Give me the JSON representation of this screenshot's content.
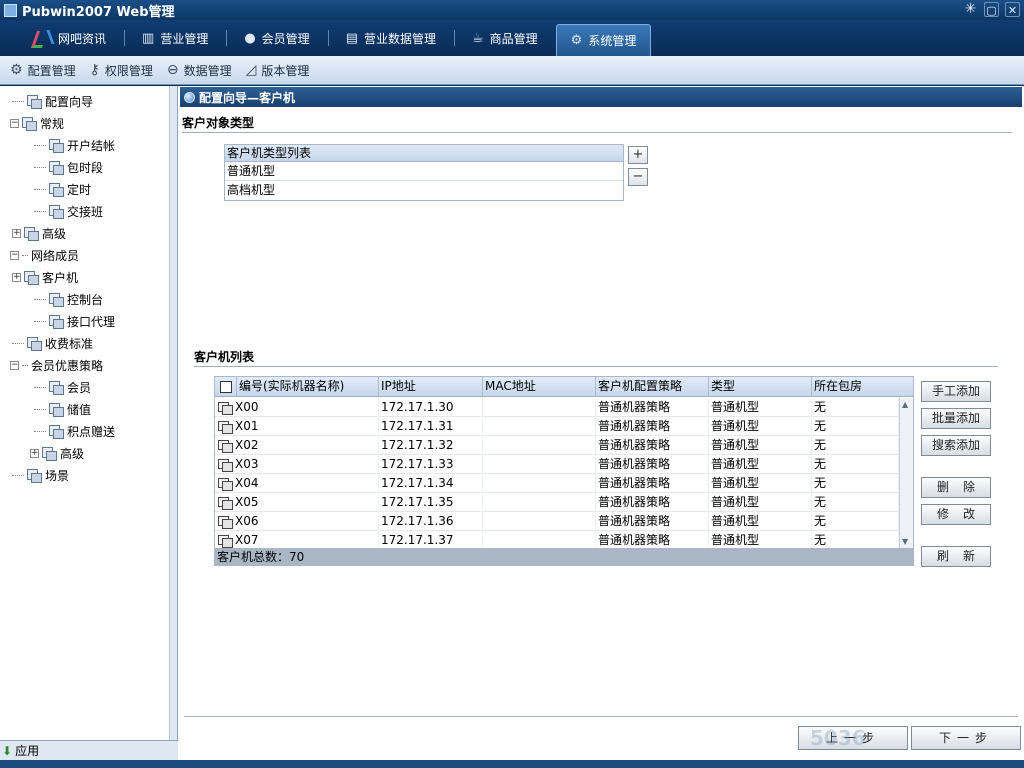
{
  "window": {
    "title": "Pubwin2007 Web管理",
    "controls": [
      "✳",
      "▢",
      "✕"
    ]
  },
  "main_nav": [
    {
      "label": "网吧资讯",
      "icon": "logo-icon"
    },
    {
      "label": "营业管理",
      "icon": "bar-chart-icon"
    },
    {
      "label": "会员管理",
      "icon": "user-icon"
    },
    {
      "label": "营业数据管理",
      "icon": "document-icon"
    },
    {
      "label": "商品管理",
      "icon": "cup-icon"
    },
    {
      "label": "系统管理",
      "icon": "gear-icon",
      "active": true
    }
  ],
  "sub_nav": [
    {
      "label": "配置管理",
      "icon": "gear-icon"
    },
    {
      "label": "权限管理",
      "icon": "key-icon"
    },
    {
      "label": "数据管理",
      "icon": "database-icon"
    },
    {
      "label": "版本管理",
      "icon": "chart-icon"
    }
  ],
  "tree": [
    {
      "label": "配置向导",
      "level": 1,
      "expander": ""
    },
    {
      "label": "常规",
      "level": 0,
      "expander": "−"
    },
    {
      "label": "开户结帐",
      "level": 2,
      "expander": ""
    },
    {
      "label": "包时段",
      "level": 2,
      "expander": ""
    },
    {
      "label": "定时",
      "level": 2,
      "expander": ""
    },
    {
      "label": "交接班",
      "level": 2,
      "expander": ""
    },
    {
      "label": "高级",
      "level": 1,
      "expander": "+"
    },
    {
      "label": "网络成员",
      "level": 0,
      "expander": "−",
      "noicon": true
    },
    {
      "label": "客户机",
      "level": 1,
      "expander": "+"
    },
    {
      "label": "控制台",
      "level": 2,
      "expander": ""
    },
    {
      "label": "接口代理",
      "level": 2,
      "expander": ""
    },
    {
      "label": "收费标准",
      "level": 1,
      "expander": ""
    },
    {
      "label": "会员优惠策略",
      "level": 0,
      "expander": "−",
      "noicon": true
    },
    {
      "label": "会员",
      "level": 2,
      "expander": ""
    },
    {
      "label": "储值",
      "level": 2,
      "expander": ""
    },
    {
      "label": "积点赠送",
      "level": 2,
      "expander": ""
    },
    {
      "label": "高级",
      "level": 0,
      "expander": "+",
      "sub": true
    },
    {
      "label": "场景",
      "level": 1,
      "expander": ""
    }
  ],
  "sidebar_footer": {
    "label": "应用"
  },
  "panel": {
    "title": "配置向导—客户机",
    "type_section_title": "客户对象类型",
    "type_list_header": "客户机类型列表",
    "type_list": [
      "普通机型",
      "高档机型"
    ],
    "add_symbol": "+",
    "remove_symbol": "−",
    "client_section_title": "客户机列表"
  },
  "client_table": {
    "columns": [
      "编号(实际机器名称)",
      "IP地址",
      "MAC地址",
      "客户机配置策略",
      "类型",
      "所在包房"
    ],
    "rows": [
      [
        "X00",
        "172.17.1.30",
        "",
        "普通机器策略",
        "普通机型",
        "无"
      ],
      [
        "X01",
        "172.17.1.31",
        "",
        "普通机器策略",
        "普通机型",
        "无"
      ],
      [
        "X02",
        "172.17.1.32",
        "",
        "普通机器策略",
        "普通机型",
        "无"
      ],
      [
        "X03",
        "172.17.1.33",
        "",
        "普通机器策略",
        "普通机型",
        "无"
      ],
      [
        "X04",
        "172.17.1.34",
        "",
        "普通机器策略",
        "普通机型",
        "无"
      ],
      [
        "X05",
        "172.17.1.35",
        "",
        "普通机器策略",
        "普通机型",
        "无"
      ],
      [
        "X06",
        "172.17.1.36",
        "",
        "普通机器策略",
        "普通机型",
        "无"
      ],
      [
        "X07",
        "172.17.1.37",
        "",
        "普通机器策略",
        "普通机型",
        "无"
      ]
    ],
    "footer": "客户机总数：70"
  },
  "side_buttons": {
    "manual_add": "手工添加",
    "batch_add": "批量添加",
    "search_add": "搜索添加",
    "delete": "删除",
    "modify": "修改",
    "refresh": "刷新"
  },
  "wizard_buttons": {
    "prev": "上一步",
    "next": "下一步"
  },
  "watermark": "5036"
}
